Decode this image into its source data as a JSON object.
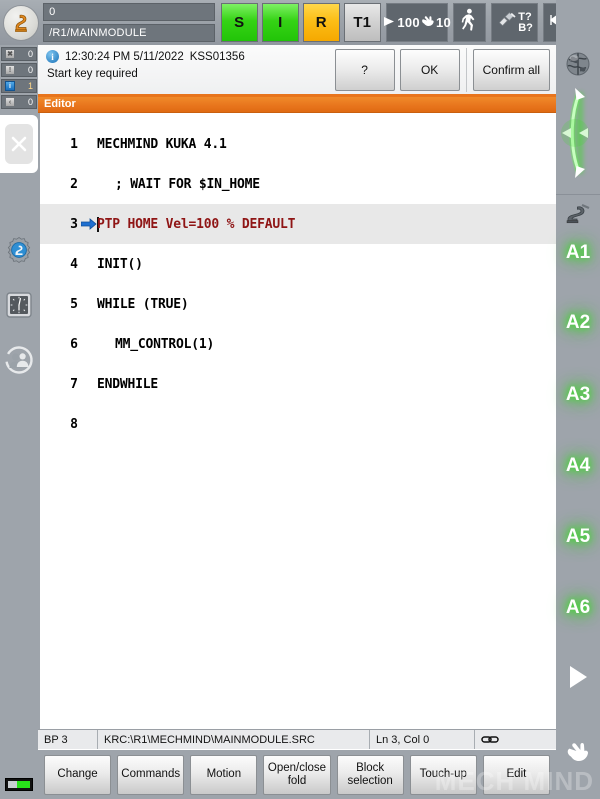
{
  "header": {
    "logo_icon": "kuka-robot-logo",
    "field_top_value": "0",
    "field_bottom_value": "/R1/MAINMODULE",
    "status_buttons": [
      {
        "label": "S",
        "state": "green"
      },
      {
        "label": "I",
        "state": "green"
      },
      {
        "label": "R",
        "state": "amber"
      },
      {
        "label": "T1",
        "state": "grey"
      }
    ],
    "override": {
      "program_icon": "play-icon",
      "program_value": "100",
      "jog_icon": "hand-icon",
      "jog_value": "10"
    },
    "walk_icon": "walking-man-icon",
    "tool_base": {
      "icon": "tool-gripper-icon",
      "tool_label": "T?",
      "base_label": "B?"
    },
    "increment_icon": "step-increment-icon",
    "increment_value": "∞"
  },
  "left_sidebar": {
    "message_counters": [
      {
        "icon": "error-icon",
        "count": "0",
        "active": false
      },
      {
        "icon": "warning-icon",
        "count": "0",
        "active": false
      },
      {
        "icon": "info-icon",
        "count": "1",
        "active": true
      },
      {
        "icon": "notification-icon",
        "count": "0",
        "active": false
      }
    ],
    "close_icon": "close-x-icon",
    "icons": [
      {
        "name": "robot-settings-gear-icon"
      },
      {
        "name": "clock-icon"
      },
      {
        "name": "users-icon"
      }
    ],
    "battery_icon": "battery-indicator"
  },
  "message_bar": {
    "info_icon": "info-circle-icon",
    "timestamp": "12:30:24 PM 5/11/2022",
    "message_code": "KSS01356",
    "message_text": "Start key required",
    "buttons": [
      {
        "name": "help",
        "label": "?"
      },
      {
        "name": "ok",
        "label": "OK"
      },
      {
        "name": "confirm-all",
        "label": "Confirm all"
      }
    ]
  },
  "editor": {
    "title": "Editor",
    "active_line": 3,
    "pointer_icon": "execution-pointer-arrow",
    "lines": [
      {
        "num": "1",
        "text": "MECHMIND KUKA 4.1",
        "indent": 0
      },
      {
        "num": "2",
        "text": "; WAIT FOR $IN_HOME",
        "indent": 1
      },
      {
        "num": "3",
        "text": "PTP HOME Vel=100 % DEFAULT",
        "indent": 0
      },
      {
        "num": "4",
        "text": "INIT()",
        "indent": 0
      },
      {
        "num": "5",
        "text": "WHILE (TRUE)",
        "indent": 0
      },
      {
        "num": "6",
        "text": "MM_CONTROL(1)",
        "indent": 1
      },
      {
        "num": "7",
        "text": "ENDWHILE",
        "indent": 0
      },
      {
        "num": "8",
        "text": "",
        "indent": 0
      }
    ],
    "status": {
      "breakpoint": "BP 3",
      "file_path": "KRC:\\R1\\MECHMIND\\MAINMODULE.SRC",
      "cursor": "Ln 3, Col 0",
      "link_icon": "chain-link-icon"
    }
  },
  "bottom_buttons": [
    {
      "name": "change",
      "label": "Change"
    },
    {
      "name": "commands",
      "label": "Commands"
    },
    {
      "name": "motion",
      "label": "Motion"
    },
    {
      "name": "open-close-fold",
      "label": "Open/close\nfold"
    },
    {
      "name": "block-selection",
      "label": "Block\nselection"
    },
    {
      "name": "touch-up",
      "label": "Touch-up"
    },
    {
      "name": "edit",
      "label": "Edit"
    }
  ],
  "right_sidebar": {
    "globe_icon": "world-coordinates-globe-icon",
    "jog_icon": "jog-direction-arrows-icon",
    "robot_icon": "robot-axis-icon",
    "axes": [
      "A1",
      "A2",
      "A3",
      "A4",
      "A5",
      "A6"
    ],
    "play_icon": "play-triangle-icon",
    "hand_icon": "hand-jog-icon"
  },
  "watermark": "MECH MIND",
  "colors": {
    "accent_orange": "#e8741c",
    "panel_grey": "#9ea4ab",
    "status_green": "#28c408",
    "status_amber": "#f5a800",
    "active_code_red": "#8f1515",
    "axis_glow_green": "#3ddc2a"
  }
}
